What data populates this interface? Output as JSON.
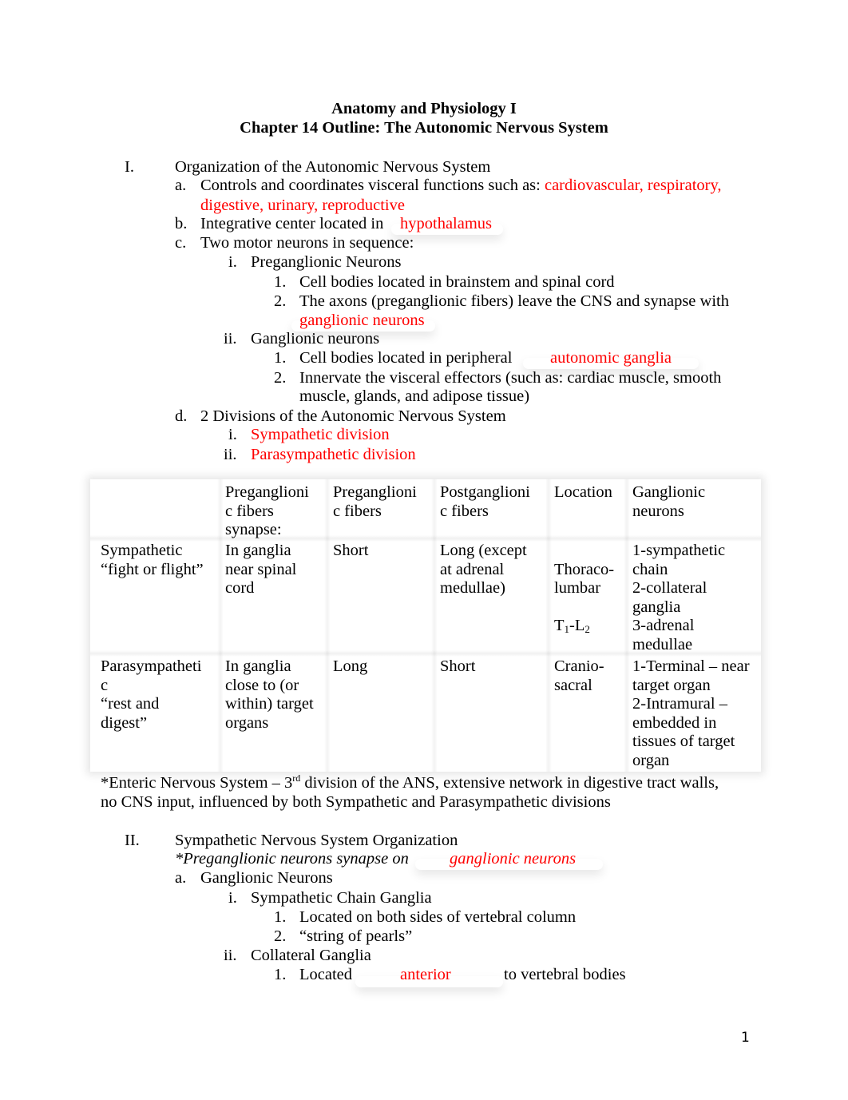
{
  "header": {
    "course_title": "Anatomy and Physiology I",
    "chapter_title": "Chapter 14 Outline: The Autonomic Nervous System"
  },
  "section1": {
    "numeral": "I.",
    "heading": "Organization of the Autonomic Nervous System",
    "a": {
      "marker": "a.",
      "text": "Controls and coordinates visceral functions such as: ",
      "answer_line1": "cardiovascular, respiratory,",
      "answer_line2": "digestive, urinary, reproductive"
    },
    "b": {
      "marker": "b.",
      "text": "Integrative center located in",
      "answer": "hypothalamus"
    },
    "c": {
      "marker": "c.",
      "text": "Two motor neurons in sequence:",
      "i": {
        "marker": "i.",
        "text": "Preganglionic Neurons",
        "items": [
          {
            "marker": "1.",
            "text": "Cell bodies located in brainstem and spinal cord"
          },
          {
            "marker": "2.",
            "text": "The axons (preganglionic fibers) leave the CNS and synapse with",
            "answer": "ganglionic neurons"
          }
        ]
      },
      "ii": {
        "marker": "ii.",
        "text": "Ganglionic neurons",
        "items": [
          {
            "marker": "1.",
            "text": "Cell bodies located in peripheral",
            "answer": "autonomic ganglia"
          },
          {
            "marker": "2.",
            "text": "Innervate the visceral effectors (such as: cardiac muscle, smooth",
            "text_line2": "muscle, glands, and adipose tissue)"
          }
        ]
      }
    },
    "d": {
      "marker": "d.",
      "text": "2 Divisions of the Autonomic Nervous System",
      "items": [
        {
          "marker": "i.",
          "answer": "Sympathetic division"
        },
        {
          "marker": "ii.",
          "answer": "Parasympathetic division"
        }
      ]
    }
  },
  "comparison_table": {
    "headers": [
      "",
      "Preganglioni\nc fibers\nsynapse:",
      "Preganglioni\nc fibers",
      "Postganglioni\nc fibers",
      "Location",
      "Ganglionic\nneurons"
    ],
    "rows": [
      {
        "division": "Sympathetic\n“fight or flight”",
        "synapse": "In ganglia\nnear spinal\ncord",
        "preganglionic": "Short",
        "postganglionic": "Long (except\nat adrenal\nmedullae)",
        "location_line1": "Thoraco-\nlumbar",
        "location_T": "T",
        "location_T_sub": "1",
        "location_dash": "-L",
        "location_L_sub": "2",
        "ganglionic": "1-sympathetic\nchain\n2-collateral\nganglia\n3-adrenal\nmedullae"
      },
      {
        "division": "Parasympatheti\nc\n“rest and\ndigest”",
        "synapse": "In ganglia\nclose to (or\nwithin) target\norgans",
        "preganglionic": "Long",
        "postganglionic": "Short",
        "location": "Cranio-\nsacral",
        "ganglionic": "1-Terminal – near\ntarget organ\n2-Intramural –\nembedded in\ntissues of target\norgan"
      }
    ]
  },
  "enteric_note": {
    "part1": "*Enteric Nervous System – 3",
    "superscript": "rd",
    "part2": " division of the ANS, extensive network in digestive tract walls,",
    "line2": "no CNS input, influenced by both Sympathetic and Parasympathetic divisions"
  },
  "section2": {
    "numeral": "II.",
    "heading": "Sympathetic Nervous System Organization",
    "note_text": "*Preganglionic neurons synapse on",
    "note_answer": "ganglionic neurons",
    "a": {
      "marker": "a.",
      "text": "Ganglionic Neurons",
      "i": {
        "marker": "i.",
        "text": "Sympathetic Chain Ganglia",
        "items": [
          {
            "marker": "1.",
            "text": "Located on both sides of vertebral column"
          },
          {
            "marker": "2.",
            "text": "“string of pearls”"
          }
        ]
      },
      "ii": {
        "marker": "ii.",
        "text": "Collateral Ganglia",
        "items": [
          {
            "marker": "1.",
            "text": "Located",
            "answer": "anterior",
            "text_after": "to vertebral bodies"
          }
        ]
      }
    }
  },
  "footer": {
    "page_number": "1"
  },
  "colors": {
    "answer": "#ff0000",
    "text": "#000000"
  }
}
